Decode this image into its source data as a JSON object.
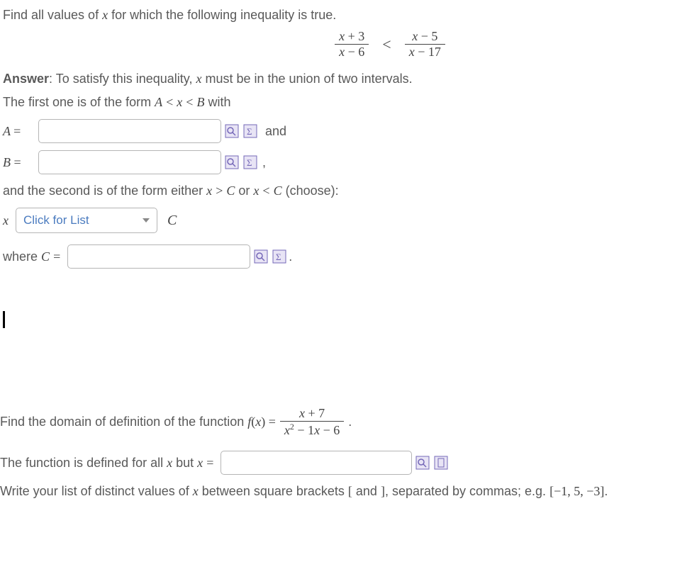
{
  "problem1": {
    "prompt": "Find all values of x for which the following inequality is true.",
    "frac1_num": "x + 3",
    "frac1_den": "x − 6",
    "frac2_num": "x − 5",
    "frac2_den": "x − 17",
    "answer_label": "Answer",
    "answer_text": ": To satisfy this inequality, x must be in the union of two intervals.",
    "line2": "The first one is of the form A < x < B with",
    "A_label": "A =",
    "and": "and",
    "B_label": "B =",
    "comma": ",",
    "line3": "and the second is of the form either x > C or x < C (choose):",
    "x": "x",
    "select_placeholder": "Click for List",
    "C": "C",
    "whereC": "where C =",
    "period": "."
  },
  "problem2": {
    "prompt_a": "Find the domain of definition of the function ",
    "fx": "f(x) =",
    "num": "x + 7",
    "den": "x² − 1x − 6",
    "period1": ".",
    "line2a": "The function is defined for all x but x =",
    "instr": "Write your list of distinct values of x between square brackets [ and ], separated by commas; e.g. [−1, 5, −3]."
  },
  "inputs": {
    "A": "",
    "B": "",
    "C": "",
    "domain": ""
  },
  "chart_data": null
}
